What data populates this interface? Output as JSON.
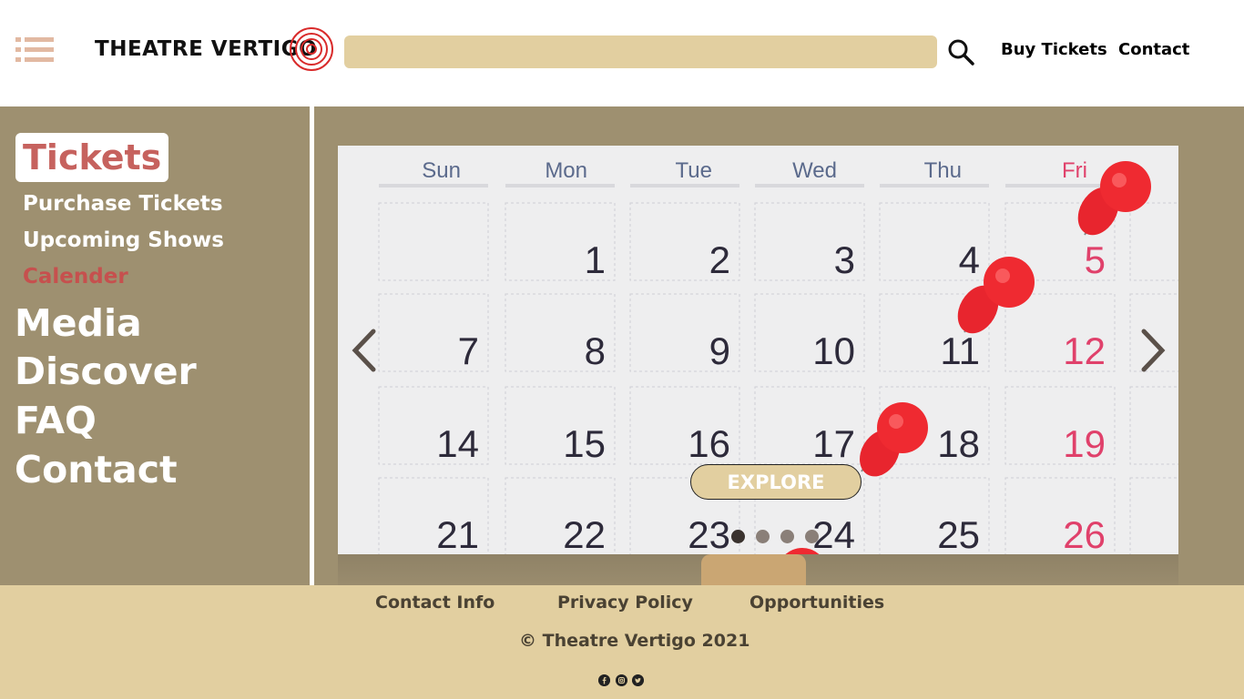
{
  "header": {
    "logo_text": "THEATRE VERTIGO",
    "search": {
      "value": "",
      "placeholder": ""
    },
    "links": [
      "Buy Tickets",
      "Contact"
    ]
  },
  "sidebar": {
    "section": "Tickets",
    "sub_items": [
      {
        "label": "Purchase Tickets",
        "active": false
      },
      {
        "label": "Upcoming Shows",
        "active": false
      },
      {
        "label": "Calender",
        "active": true
      }
    ],
    "main_items": [
      "Media",
      "Discover",
      "FAQ",
      "Contact"
    ]
  },
  "carousel": {
    "explore_label": "EXPLORE",
    "slide_count": 4,
    "active_index": 0,
    "calendar": {
      "days": [
        "Sun",
        "Mon",
        "Tue",
        "Wed",
        "Thu",
        "Fri"
      ],
      "rows": [
        [
          "",
          "1",
          "2",
          "3",
          "4",
          "5"
        ],
        [
          "7",
          "8",
          "9",
          "10",
          "11",
          "12"
        ],
        [
          "14",
          "15",
          "16",
          "17",
          "18",
          "19"
        ],
        [
          "21",
          "22",
          "23",
          "24",
          "25",
          "26"
        ]
      ]
    }
  },
  "footer": {
    "links": [
      "Contact Info",
      "Privacy Policy",
      "Opportunities"
    ],
    "copyright": "© Theatre Vertigo 2021",
    "social": [
      "facebook-icon",
      "instagram-icon",
      "twitter-icon"
    ]
  },
  "colors": {
    "sand": "#e2cfa0",
    "olive": "#9e9070",
    "accent_red": "#c6504e",
    "tab_red": "#c6625e",
    "pin_red": "#e8252e"
  }
}
